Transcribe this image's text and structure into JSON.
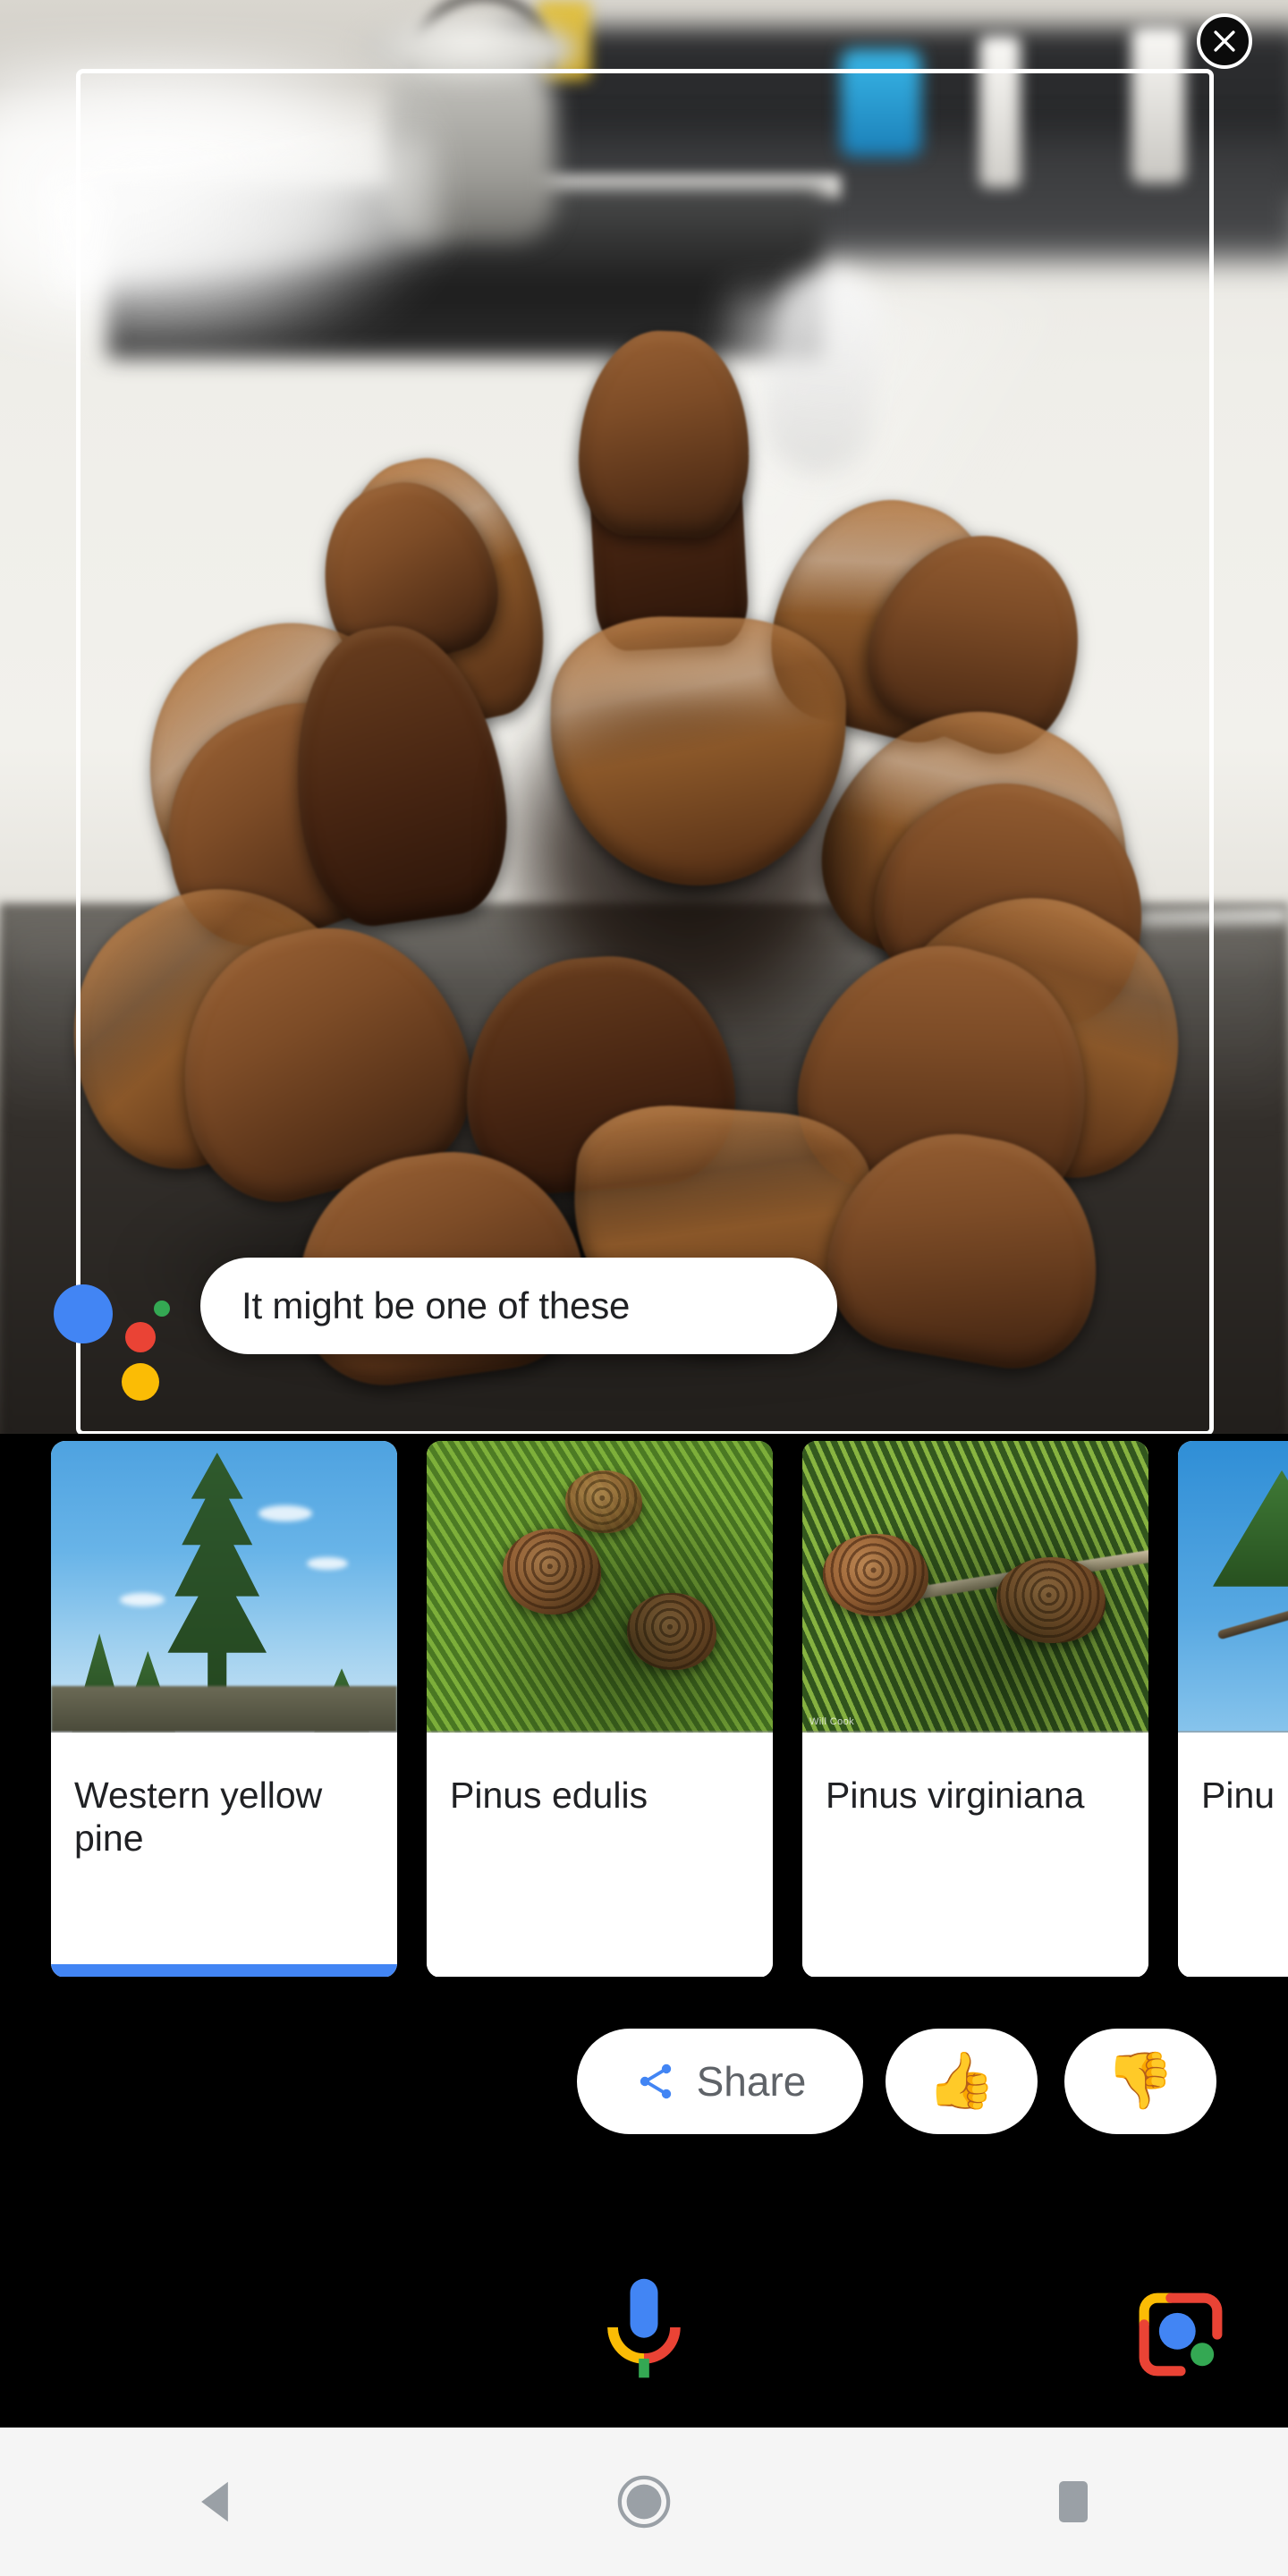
{
  "app": {
    "name": "Google Lens",
    "screen": "visual-search-results"
  },
  "viewfinder": {
    "close_icon": "close-icon",
    "subject": "pine cone",
    "frame_color": "#ffffff"
  },
  "assistant": {
    "message": "It might be one of these",
    "dots": [
      "blue",
      "red",
      "green",
      "yellow"
    ],
    "dot_colors": {
      "blue": "#4285F4",
      "red": "#EA4335",
      "green": "#34A853",
      "yellow": "#FBBC05"
    }
  },
  "results": {
    "cards": [
      {
        "label": "Western yellow pine",
        "selected": true,
        "thumb": "tall-pine-tree-blue-sky"
      },
      {
        "label": "Pinus edulis",
        "selected": false,
        "thumb": "pinyon-cones-on-green-needles"
      },
      {
        "label": "Pinus virginiana",
        "selected": false,
        "thumb": "two-cones-on-branch",
        "watermark": "Will Cook"
      },
      {
        "label": "Pinu",
        "selected": false,
        "thumb": "pine-branches-blue-sky"
      }
    ],
    "selection_color": "#4285F4"
  },
  "actions": {
    "share_label": "Share",
    "share_icon": "share-icon",
    "share_icon_color": "#4285F4",
    "share_text_color": "#5F6368",
    "thumbs_up_icon": "👍",
    "thumbs_down_icon": "👎"
  },
  "bottom_bar": {
    "mic_icon": "microphone-icon",
    "lens_icon": "google-lens-icon"
  },
  "navbar": {
    "back_icon": "back-triangle-icon",
    "home_icon": "home-circle-icon",
    "recents_icon": "recents-square-icon",
    "background": "#f5f5f5",
    "icon_color": "#9aa0a6"
  }
}
